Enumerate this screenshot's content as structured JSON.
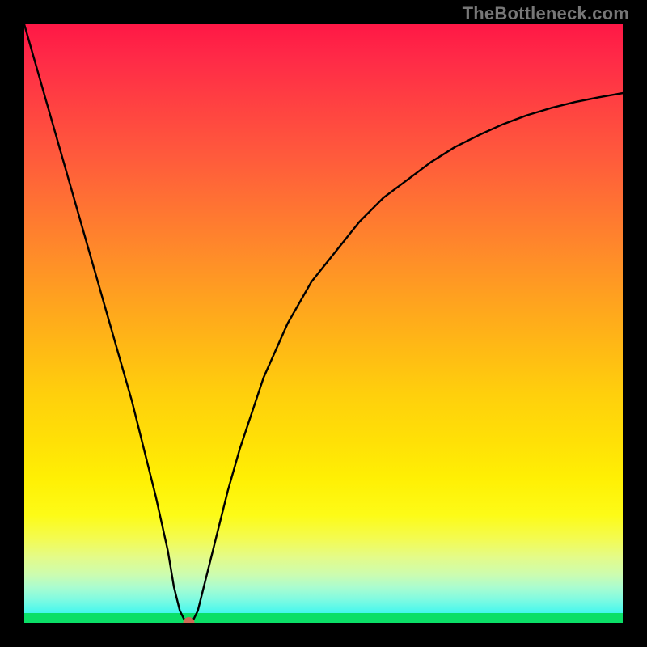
{
  "watermark": {
    "text": "TheBottleneck.com"
  },
  "chart_data": {
    "type": "line",
    "title": "",
    "xlabel": "",
    "ylabel": "",
    "xlim": [
      0,
      100
    ],
    "ylim": [
      0,
      100
    ],
    "grid": false,
    "legend": false,
    "annotations": [],
    "gradient_stops": [
      {
        "pos": 0,
        "color": "#ff1846"
      },
      {
        "pos": 14,
        "color": "#ff4341"
      },
      {
        "pos": 30,
        "color": "#ff7233"
      },
      {
        "pos": 46,
        "color": "#ffa21f"
      },
      {
        "pos": 62,
        "color": "#ffd00c"
      },
      {
        "pos": 76,
        "color": "#fff004"
      },
      {
        "pos": 86,
        "color": "#f3fb52"
      },
      {
        "pos": 92,
        "color": "#ccfcb0"
      },
      {
        "pos": 96,
        "color": "#82fbe0"
      },
      {
        "pos": 100,
        "color": "#13f4f3"
      }
    ],
    "series": [
      {
        "name": "curve",
        "x": [
          0,
          2,
          4,
          6,
          8,
          10,
          12,
          14,
          16,
          18,
          20,
          22,
          24,
          25,
          26,
          27,
          28,
          29,
          30,
          32,
          34,
          36,
          38,
          40,
          44,
          48,
          52,
          56,
          60,
          64,
          68,
          72,
          76,
          80,
          84,
          88,
          92,
          96,
          100
        ],
        "y": [
          100,
          93,
          86,
          79,
          72,
          65,
          58,
          51,
          44,
          37,
          29,
          21,
          12,
          6,
          2,
          0,
          0,
          2,
          6,
          14,
          22,
          29,
          35,
          41,
          50,
          57,
          62,
          67,
          71,
          74,
          77,
          79.5,
          81.5,
          83.3,
          84.8,
          86,
          87,
          87.8,
          88.5
        ]
      }
    ],
    "marker": {
      "x": 27.5,
      "y": 0,
      "color": "#cf6a55",
      "radius_px": 7
    }
  }
}
